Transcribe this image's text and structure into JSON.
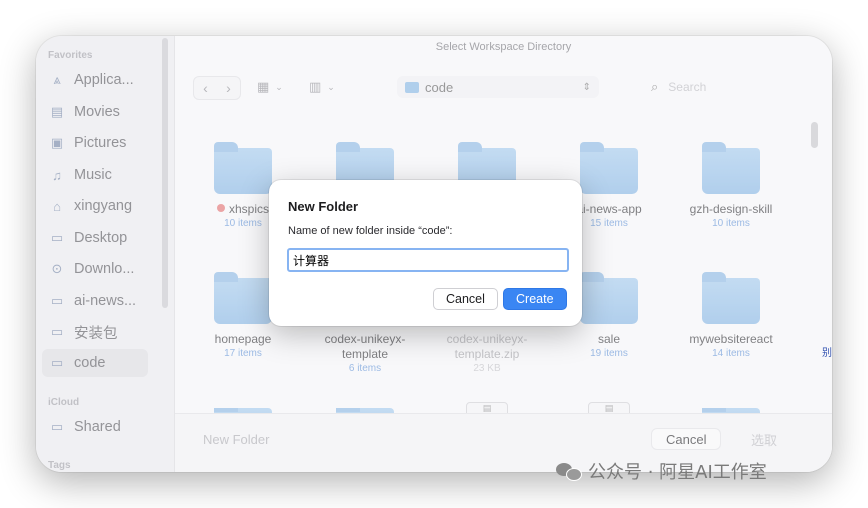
{
  "window": {
    "title": "Select Workspace Directory"
  },
  "sidebar": {
    "favorites_label": "Favorites",
    "icloud_label": "iCloud",
    "tags_label": "Tags",
    "items": [
      {
        "label": "Applica...",
        "icon": "applications-icon"
      },
      {
        "label": "Movies",
        "icon": "movies-icon"
      },
      {
        "label": "Pictures",
        "icon": "pictures-icon"
      },
      {
        "label": "Music",
        "icon": "music-icon"
      },
      {
        "label": "xingyang",
        "icon": "home-icon"
      },
      {
        "label": "Desktop",
        "icon": "desktop-icon"
      },
      {
        "label": "Downlo...",
        "icon": "downloads-icon"
      },
      {
        "label": "ai-news...",
        "icon": "folder-icon"
      },
      {
        "label": "安装包",
        "icon": "folder-icon"
      },
      {
        "label": "code",
        "icon": "folder-icon",
        "active": true
      }
    ],
    "shared": {
      "label": "Shared",
      "icon": "shared-folder-icon"
    }
  },
  "toolbar": {
    "path_label": "code",
    "search_placeholder": "Search"
  },
  "folders": [
    {
      "name": "xhspics",
      "count": "10 items",
      "tag": "red"
    },
    {
      "name": "",
      "count": ""
    },
    {
      "name": "",
      "count": ""
    },
    {
      "name": "ai-news-app",
      "count": "15 items"
    },
    {
      "name": "gzh-design-skill",
      "count": "10 items"
    },
    {
      "name": "homepage",
      "count": "17 items"
    },
    {
      "name": "codex-unikeyx-template",
      "count": "6 items"
    },
    {
      "name": "codex-unikeyx-template.zip",
      "count": "23 KB",
      "dimmed": true
    },
    {
      "name": "sale",
      "count": "19 items"
    },
    {
      "name": "mywebsitereact",
      "count": "14 items"
    }
  ],
  "bottom": {
    "new_folder_label": "New Folder",
    "cancel_label": "Cancel",
    "select_label": "选取"
  },
  "dialog": {
    "title": "New Folder",
    "label": "Name of new folder inside “code”:",
    "input_value": "计算器",
    "cancel_label": "Cancel",
    "create_label": "Create",
    "accent_color": "#3a86f3"
  },
  "watermark": {
    "text": "公众号 · 阿星AI工作室"
  },
  "edge_mark": "别"
}
